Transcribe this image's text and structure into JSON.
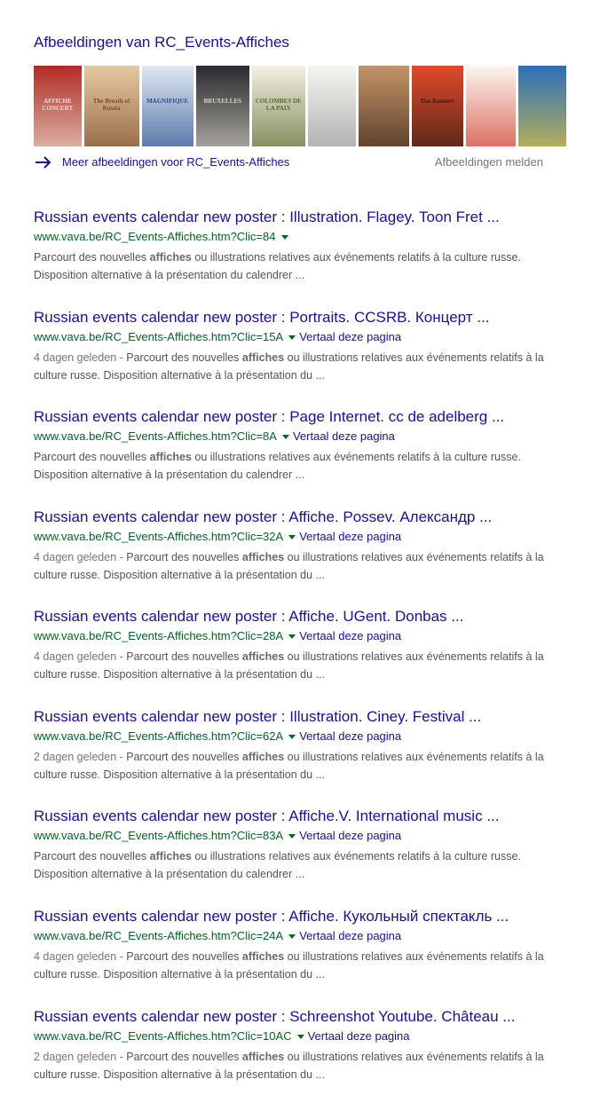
{
  "images": {
    "title": "Afbeeldingen van RC_Events-Affiches",
    "more_link": "Meer afbeeldingen voor RC_Events-Affiches",
    "report": "Afbeeldingen melden",
    "thumbnails": [
      {
        "name": "thumb-1",
        "bg": "#b12b25",
        "accent": "#e9e3d2",
        "caption": "AFFICHE CONCERT"
      },
      {
        "name": "thumb-2",
        "bg": "#e6c9a0",
        "accent": "#7b4b2a",
        "caption": "The Breath of Russia"
      },
      {
        "name": "thumb-3",
        "bg": "#dfe8f2",
        "accent": "#2a4f8e",
        "caption": "MAGNIFIQUE"
      },
      {
        "name": "thumb-4",
        "bg": "#2a2a2f",
        "accent": "#d6d2c8",
        "caption": "BRUXELLES"
      },
      {
        "name": "thumb-5",
        "bg": "#f3f1e4",
        "accent": "#5a6a2a",
        "caption": "COLOMBES DE LA PAIX"
      },
      {
        "name": "thumb-6",
        "bg": "#f5f5f2",
        "accent": "#999999",
        "caption": ""
      },
      {
        "name": "thumb-7",
        "bg": "#c49467",
        "accent": "#3a2418",
        "caption": ""
      },
      {
        "name": "thumb-8",
        "bg": "#e14a2b",
        "accent": "#2c1c14",
        "caption": "Das Konzert"
      },
      {
        "name": "thumb-9",
        "bg": "#fbf7ef",
        "accent": "#d23b2b",
        "caption": ""
      },
      {
        "name": "thumb-10",
        "bg": "#2d6fb8",
        "accent": "#e8c53a",
        "caption": ""
      }
    ]
  },
  "results": [
    {
      "title": "Russian events calendar new poster : Illustration. Flagey. Toon Fret ...",
      "url": "www.vava.be/RC_Events-Affiches.htm?Clic=84",
      "translate": "",
      "date": "",
      "s1": "Parcourt des nouvelles ",
      "s_bold": "affiches",
      "s2": " ou illustrations relatives aux événements relatifs à la culture russe. Disposition alternative à la présentation du calendrer ..."
    },
    {
      "title": "Russian events calendar new poster : Portraits. CCSRB. Концерт ...",
      "url": "www.vava.be/RC_Events-Affiches.htm?Clic=15A",
      "translate": "Vertaal deze pagina",
      "date": "4 dagen geleden - ",
      "s1": "Parcourt des nouvelles ",
      "s_bold": "affiches",
      "s2": " ou illustrations relatives aux événements relatifs à la culture russe. Disposition alternative à la présentation du ..."
    },
    {
      "title": "Russian events calendar new poster : Page Internet. cc de adelberg ...",
      "url": "www.vava.be/RC_Events-Affiches.htm?Clic=8A",
      "translate": "Vertaal deze pagina",
      "date": "",
      "s1": "Parcourt des nouvelles ",
      "s_bold": "affiches",
      "s2": " ou illustrations relatives aux événements relatifs à la culture russe. Disposition alternative à la présentation du calendrer ..."
    },
    {
      "title": "Russian events calendar new poster : Affiche. Possev. Александр ...",
      "url": "www.vava.be/RC_Events-Affiches.htm?Clic=32A",
      "translate": "Vertaal deze pagina",
      "date": "4 dagen geleden - ",
      "s1": "Parcourt des nouvelles ",
      "s_bold": "affiches",
      "s2": " ou illustrations relatives aux événements relatifs à la culture russe. Disposition alternative à la présentation du ..."
    },
    {
      "title": "Russian events calendar new poster : Affiche. UGent. Donbas ...",
      "url": "www.vava.be/RC_Events-Affiches.htm?Clic=28A",
      "translate": "Vertaal deze pagina",
      "date": "4 dagen geleden - ",
      "s1": "Parcourt des nouvelles ",
      "s_bold": "affiches",
      "s2": " ou illustrations relatives aux événements relatifs à la culture russe. Disposition alternative à la présentation du ..."
    },
    {
      "title": "Russian events calendar new poster : Illustration. Ciney. Festival ...",
      "url": "www.vava.be/RC_Events-Affiches.htm?Clic=62A",
      "translate": "Vertaal deze pagina",
      "date": "2 dagen geleden - ",
      "s1": "Parcourt des nouvelles ",
      "s_bold": "affiches",
      "s2": " ou illustrations relatives aux événements relatifs à la culture russe. Disposition alternative à la présentation du ..."
    },
    {
      "title": "Russian events calendar new poster : Affiche.V. International music ...",
      "url": "www.vava.be/RC_Events-Affiches.htm?Clic=83A",
      "translate": "Vertaal deze pagina",
      "date": "",
      "s1": "Parcourt des nouvelles ",
      "s_bold": "affiches",
      "s2": " ou illustrations relatives aux événements relatifs à la culture russe. Disposition alternative à la présentation du calendrer ..."
    },
    {
      "title": "Russian events calendar new poster : Affiche. Кукольный спектакль ...",
      "url": "www.vava.be/RC_Events-Affiches.htm?Clic=24A",
      "translate": "Vertaal deze pagina",
      "date": "4 dagen geleden - ",
      "s1": "Parcourt des nouvelles ",
      "s_bold": "affiches",
      "s2": " ou illustrations relatives aux événements relatifs à la culture russe. Disposition alternative à la présentation du ..."
    },
    {
      "title": "Russian events calendar new poster : Schreenshot Youtube. Château ...",
      "url": "www.vava.be/RC_Events-Affiches.htm?Clic=10AC",
      "translate": "Vertaal deze pagina",
      "date": "2 dagen geleden - ",
      "s1": "Parcourt des nouvelles ",
      "s_bold": "affiches",
      "s2": " ou illustrations relatives aux événements relatifs à la culture russe. Disposition alternative à la présentation du ..."
    }
  ],
  "colors": {
    "link": "#1a0dab",
    "url": "#006621",
    "snippet": "#545454",
    "meta": "#777777"
  }
}
